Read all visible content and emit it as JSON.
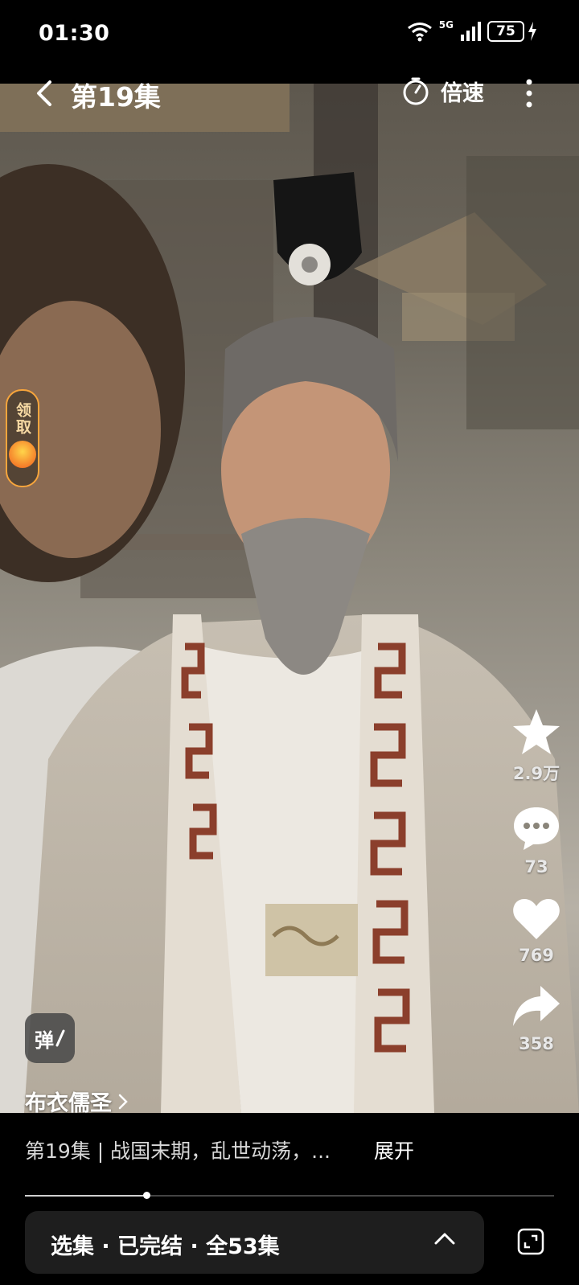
{
  "status_bar": {
    "time": "01:30",
    "network": "5G",
    "battery": "75"
  },
  "header": {
    "title": "第19集",
    "speed_label": "倍速"
  },
  "reward_widget": {
    "label": "领取"
  },
  "actions": {
    "favorite_count": "2.9万",
    "comment_count": "73",
    "like_count": "769",
    "share_count": "358"
  },
  "danmaku": {
    "label": "弹"
  },
  "author": {
    "name": "布衣儒圣"
  },
  "description": {
    "text": "第19集 | 战国末期，乱世动荡，...",
    "expand_label": "展开"
  },
  "playback": {
    "progress_fraction": 0.23
  },
  "episodes": {
    "label": "选集 · 已完结 · 全53集"
  },
  "colors": {
    "accent_orange": "#f7a53c",
    "background": "#000000"
  }
}
